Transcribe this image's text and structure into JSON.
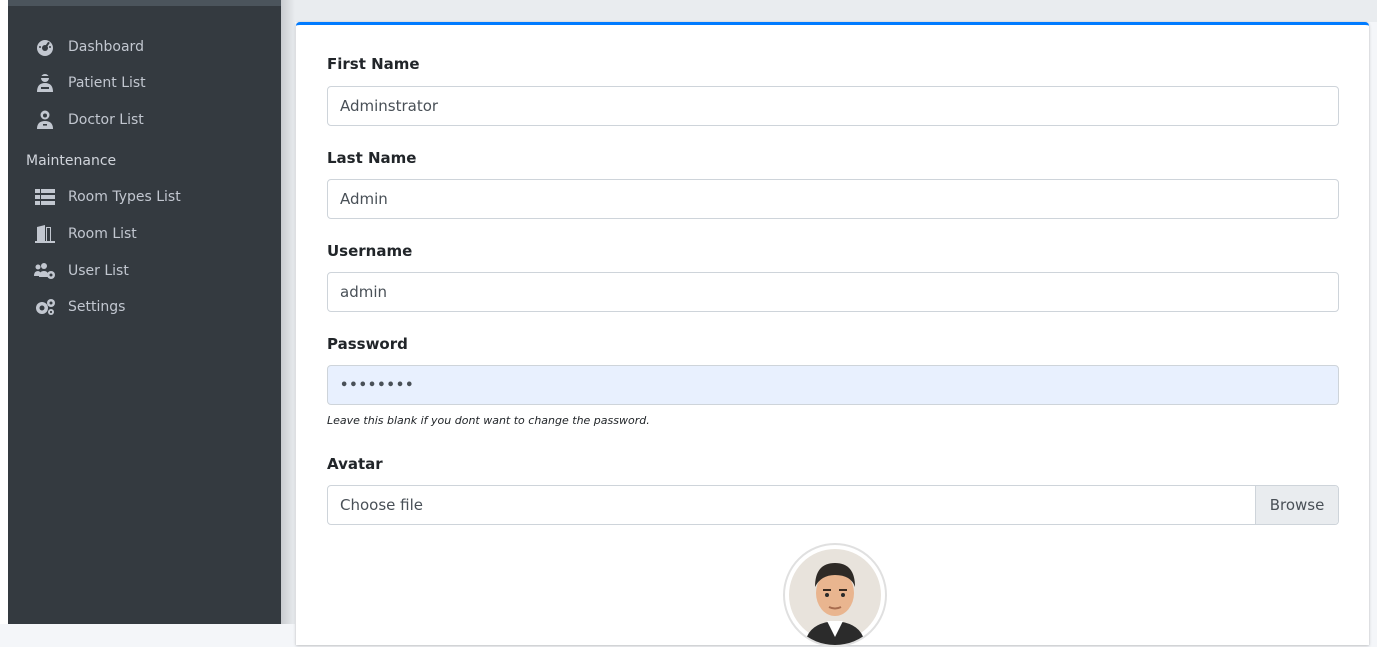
{
  "sidebar": {
    "items": [
      {
        "label": "Dashboard",
        "icon": "tachometer-icon"
      },
      {
        "label": "Patient List",
        "icon": "user-injured-icon"
      },
      {
        "label": "Doctor List",
        "icon": "user-md-icon"
      }
    ],
    "maintenance_header": "Maintenance",
    "maintenance_items": [
      {
        "label": "Room Types List",
        "icon": "list-icon"
      },
      {
        "label": "Room List",
        "icon": "door-open-icon"
      },
      {
        "label": "User List",
        "icon": "users-cog-icon"
      },
      {
        "label": "Settings",
        "icon": "cogs-icon"
      }
    ]
  },
  "form": {
    "first_name_label": "First Name",
    "first_name_value": "Adminstrator",
    "last_name_label": "Last Name",
    "last_name_value": "Admin",
    "username_label": "Username",
    "username_value": "admin",
    "password_label": "Password",
    "password_value": "••••••••",
    "password_help": "Leave this blank if you dont want to change the password.",
    "avatar_label": "Avatar",
    "avatar_file_text": "Choose file",
    "browse_label": "Browse"
  },
  "colors": {
    "sidebar_bg": "#343a40",
    "accent": "#007bff",
    "autofill_bg": "#e8f0fe"
  }
}
